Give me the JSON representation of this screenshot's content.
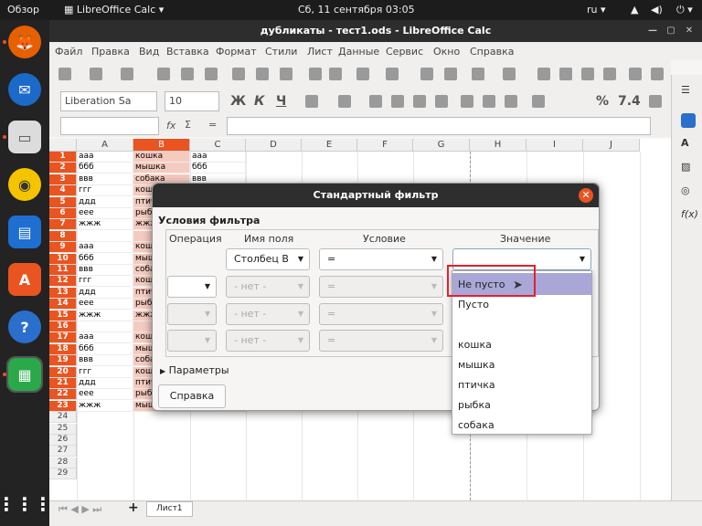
{
  "topbar": {
    "overview": "Обзор",
    "app": "LibreOffice Calc",
    "clock": "Сб, 11 сентября  03:05",
    "lang": "ru"
  },
  "window": {
    "title": "дубликаты - тест1.ods - LibreOffice Calc"
  },
  "menu": [
    "Файл",
    "Правка",
    "Вид",
    "Вставка",
    "Формат",
    "Стили",
    "Лист",
    "Данные",
    "Сервис",
    "Окно",
    "Справка"
  ],
  "format": {
    "font": "Liberation Sa",
    "size": "10",
    "bold": "Ж",
    "italic": "К",
    "underline": "Ч",
    "percent": "%",
    "number": "7.4"
  },
  "formula": {
    "fx": "fx",
    "sum": "Σ",
    "eq": "="
  },
  "columns": [
    "A",
    "B",
    "C",
    "D",
    "E",
    "F",
    "G",
    "H",
    "I",
    "J"
  ],
  "rows": [
    "1",
    "2",
    "3",
    "4",
    "5",
    "6",
    "7",
    "8",
    "9",
    "10",
    "11",
    "12",
    "13",
    "14",
    "15",
    "16",
    "17",
    "18",
    "19",
    "20",
    "21",
    "22",
    "23",
    "24",
    "25",
    "26",
    "27",
    "28",
    "29"
  ],
  "colA": [
    "ааа",
    "ббб",
    "ввв",
    "ггг",
    "ддд",
    "еее",
    "жжж",
    "",
    "ааа",
    "ббб",
    "ввв",
    "ггг",
    "ддд",
    "еее",
    "жжж",
    "",
    "ааа",
    "ббб",
    "ввв",
    "ггг",
    "ддд",
    "еее",
    "жжж"
  ],
  "colB": [
    "кошка",
    "мышка",
    "собака",
    "кош",
    "птич",
    "рыб",
    "жжж",
    "",
    "кош",
    "мыш",
    "соба",
    "кош",
    "птич",
    "рыб",
    "жжж",
    "",
    "кош",
    "мыш",
    "соба",
    "кош",
    "птич",
    "рыб",
    "мышка"
  ],
  "colC": [
    "ааа",
    "ббб",
    "ввв",
    "",
    "",
    "",
    "",
    "",
    "",
    "",
    "",
    "",
    "",
    "",
    "",
    "",
    "",
    "",
    "",
    "",
    "",
    "",
    "жжж"
  ],
  "sheet_tab": "Лист1",
  "dialog": {
    "title": "Стандартный фильтр",
    "section": "Условия фильтра",
    "headers": {
      "operation": "Операция",
      "field": "Имя поля",
      "condition": "Условие",
      "value": "Значение"
    },
    "row1": {
      "field": "Столбец B",
      "condition": "="
    },
    "row2": {
      "field": "- нет -",
      "condition": "="
    },
    "row3": {
      "field": "- нет -",
      "condition": "="
    },
    "row4": {
      "field": "- нет -",
      "condition": "="
    },
    "options": "Параметры",
    "help": "Справка"
  },
  "dropdown": [
    "Не пусто",
    "Пусто",
    "",
    "кошка",
    "мышка",
    "птичка",
    "рыбка",
    "собака"
  ],
  "colors": {
    "accent": "#e95420",
    "highlight": "#a9a6d8",
    "redbox": "#e3202e"
  }
}
